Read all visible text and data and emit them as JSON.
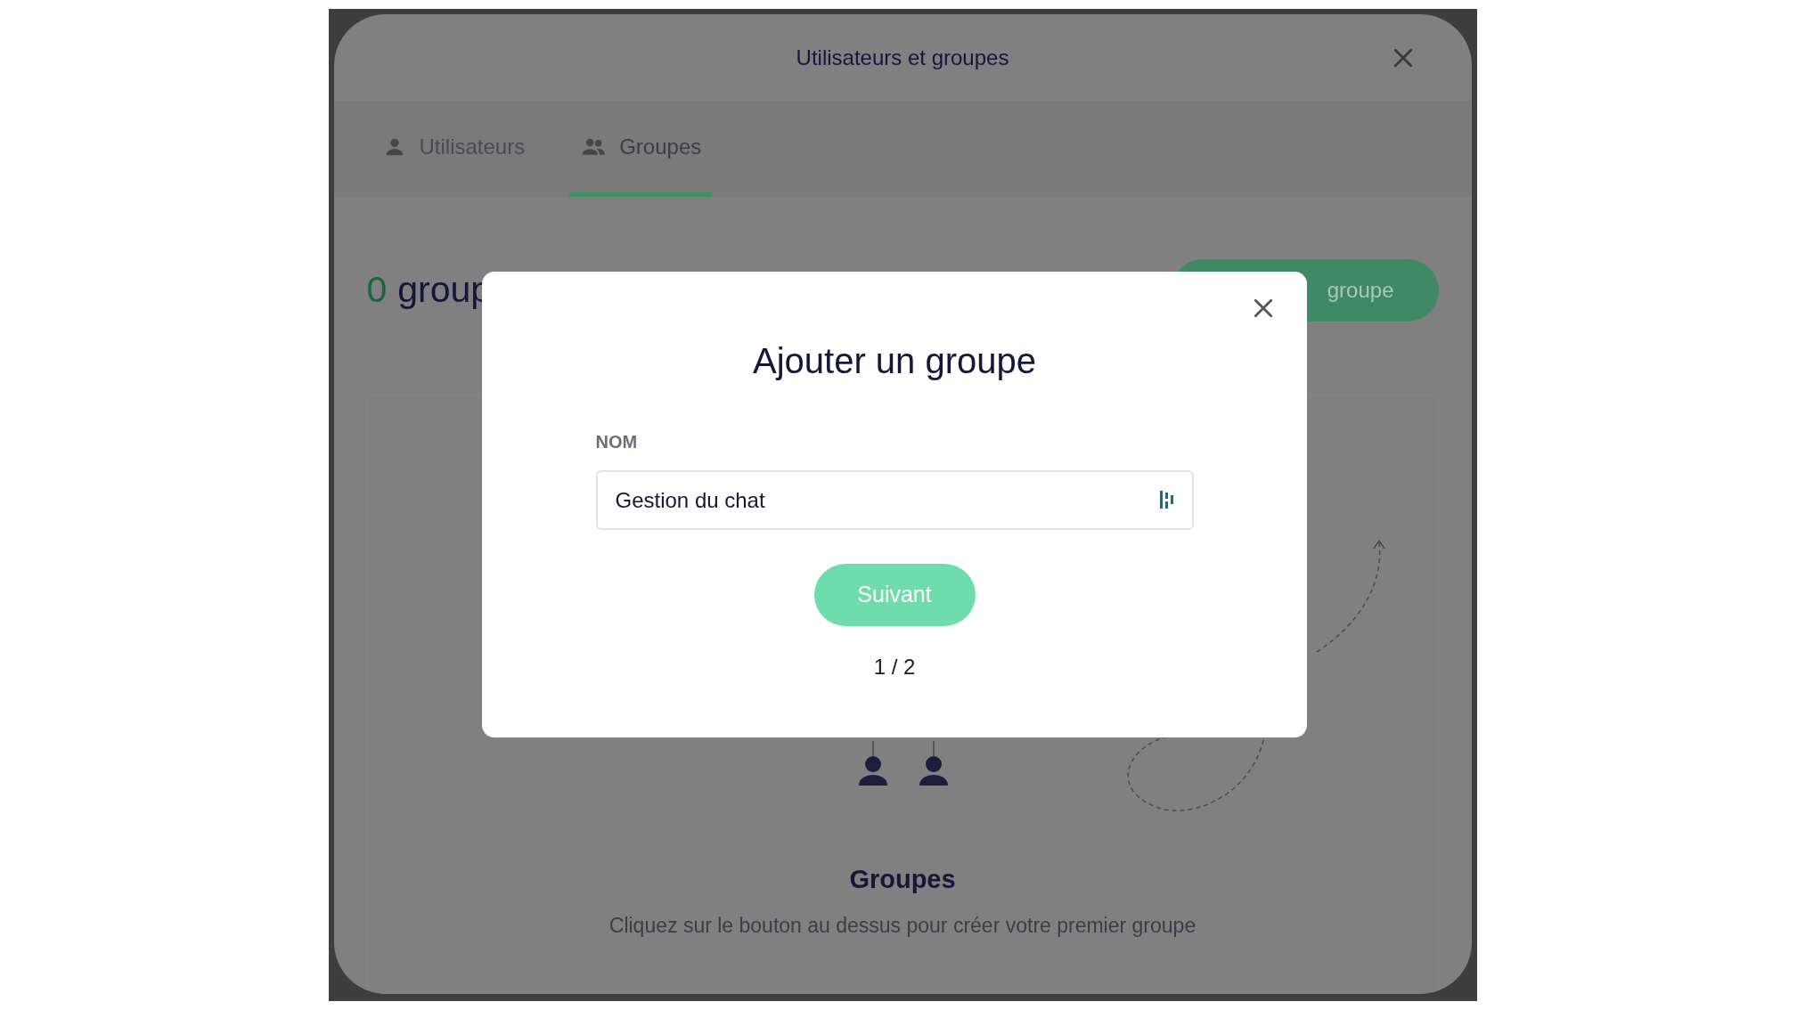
{
  "window": {
    "title": "Utilisateurs et groupes"
  },
  "tabs": [
    {
      "label": "Utilisateurs",
      "kind": "person",
      "selected": false
    },
    {
      "label": "Groupes",
      "kind": "group",
      "selected": true
    }
  ],
  "header": {
    "count": "0",
    "label": "group"
  },
  "add_button": {
    "label": "groupe"
  },
  "empty_state": {
    "title": "Groupes",
    "text": "Cliquez sur le bouton au dessus pour créer votre premier groupe"
  },
  "dialog": {
    "title": "Ajouter un groupe",
    "field": {
      "label": "NOM",
      "value": "Gestion du chat"
    },
    "button": "Suivant",
    "step": "1 / 2"
  }
}
